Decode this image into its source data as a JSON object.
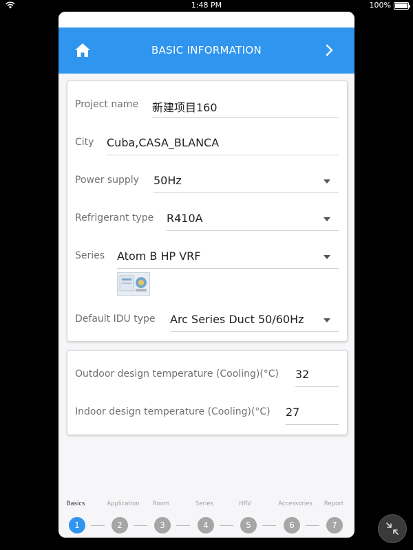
{
  "status_bar": {
    "time": "1:48 PM",
    "battery": "100%"
  },
  "header": {
    "title": "BASIC INFORMATION"
  },
  "form": {
    "project_name": {
      "label": "Project name",
      "value": "新建项目160"
    },
    "city": {
      "label": "City",
      "value": "Cuba,CASA_BLANCA"
    },
    "power_supply": {
      "label": "Power supply",
      "value": "50Hz"
    },
    "refrigerant": {
      "label": "Refrigerant type",
      "value": "R410A"
    },
    "series": {
      "label": "Series",
      "value": "Atom B HP VRF"
    },
    "default_idu": {
      "label": "Default IDU type",
      "value": "Arc Series Duct 50/60Hz"
    }
  },
  "temperatures": {
    "outdoor": {
      "label": "Outdoor design temperature (Cooling)(°C)",
      "value": "32"
    },
    "indoor": {
      "label": "Indoor design temperature (Cooling)(°C)",
      "value": "27"
    }
  },
  "steps": [
    {
      "label": "Basics",
      "number": "1"
    },
    {
      "label": "Application",
      "number": "2"
    },
    {
      "label": "Room",
      "number": "3"
    },
    {
      "label": "Series",
      "number": "4"
    },
    {
      "label": "HRV",
      "number": "5"
    },
    {
      "label": "Accessories",
      "number": "6"
    },
    {
      "label": "Report",
      "number": "7"
    }
  ],
  "colors": {
    "accent": "#2f95ee",
    "inactive_step": "#a6a6a6"
  }
}
